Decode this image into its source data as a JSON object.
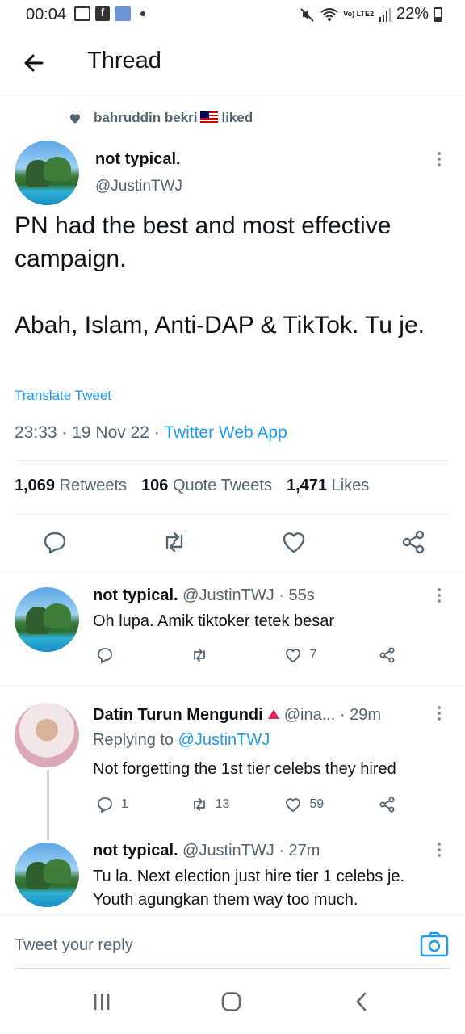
{
  "status_bar": {
    "time": "00:04",
    "lte_label": "Vo) LTE2",
    "battery": "22%"
  },
  "header": {
    "title": "Thread"
  },
  "main_tweet": {
    "liked_by": "bahruddin bekri",
    "liked_suffix": "liked",
    "author_name": "not typical.",
    "author_handle": "@JustinTWJ",
    "text_line1": "PN had the best and most effective campaign.",
    "text_line2": "Abah, Islam, Anti-DAP & TikTok. Tu je.",
    "translate": "Translate Tweet",
    "time": "23:33 · 19 Nov 22 · ",
    "source": "Twitter Web App",
    "retweets_count": "1,069",
    "retweets_label": "Retweets",
    "quotes_count": "106",
    "quotes_label": "Quote Tweets",
    "likes_count": "1,471",
    "likes_label": "Likes"
  },
  "replies": [
    {
      "name": "not typical.",
      "meta": " @JustinTWJ · 55s",
      "text": "Oh lupa. Amik tiktoker tetek besar",
      "likes": "7"
    },
    {
      "name": "Datin Turun Mengundi",
      "meta": "@ina... · 29m",
      "replying_label": "Replying to ",
      "replying_to": "@JustinTWJ",
      "text": "Not forgetting the 1st tier celebs they hired",
      "replies": "1",
      "retweets": "13",
      "likes": "59"
    },
    {
      "name": "not typical.",
      "meta": " @JustinTWJ · 27m",
      "text_line1": "Tu la. Next election just hire tier 1 celebs je.",
      "text_line2": "Youth agungkan them way too much."
    }
  ],
  "reply_bar": {
    "placeholder": "Tweet your reply"
  },
  "colors": {
    "link": "#1d9bf0",
    "secondary": "#536471",
    "primary_text": "#0f1419"
  }
}
